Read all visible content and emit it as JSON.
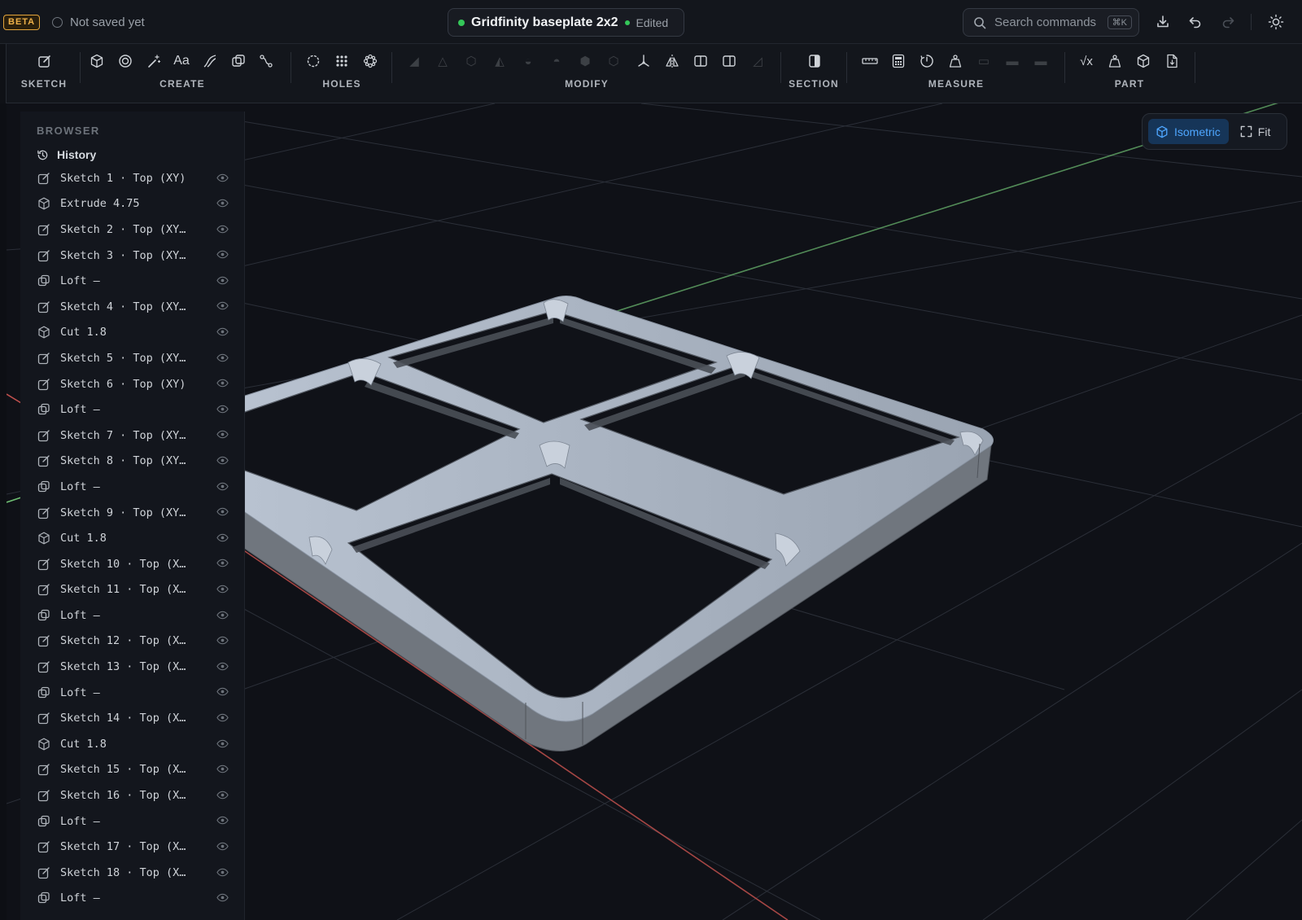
{
  "topbar": {
    "beta_label": "BETA",
    "save_status": "Not saved yet",
    "doc_title": "Gridfinity baseplate 2x2",
    "doc_state": "Edited",
    "search_placeholder": "Search commands",
    "search_shortcut": "⌘K",
    "icons": [
      "download-icon",
      "undo-icon",
      "redo-icon",
      "theme-sun-icon"
    ]
  },
  "ribbon": {
    "groups": [
      {
        "label": "SKETCH",
        "tools": [
          "sketch-icon"
        ]
      },
      {
        "label": "CREATE",
        "tools": [
          "extrude-icon",
          "revolve-icon",
          "magic-icon",
          "text-tool-icon",
          "loft-icon",
          "shape-icon",
          "sweep-icon"
        ]
      },
      {
        "label": "HOLES",
        "tools": [
          "hole-icon",
          "rect-pattern-icon",
          "circular-pattern-icon"
        ]
      },
      {
        "label": "MODIFY",
        "tools": [
          "fillet-icon",
          "chamfer-icon",
          "shell-icon",
          "draft-icon",
          "combine-icon",
          "offset-icon",
          "split-icon",
          "thicken-icon",
          "move-icon",
          "mirror-icon",
          "split-body-icon",
          "split-face-icon",
          "replace-icon"
        ]
      },
      {
        "label": "SECTION",
        "tools": [
          "section-icon"
        ]
      },
      {
        "label": "MEASURE",
        "tools": [
          "ruler-icon",
          "calculator-icon",
          "angle-icon",
          "mass-icon",
          "measure-a-icon",
          "measure-b-icon",
          "measure-c-icon"
        ]
      },
      {
        "label": "PART",
        "tools": [
          "sqrt-icon",
          "weight-icon",
          "part-cube-icon",
          "export-file-icon"
        ]
      }
    ]
  },
  "browser": {
    "title": "BROWSER",
    "history_label": "History",
    "items": [
      {
        "icon": "sketch",
        "label": "Sketch 1 · Top (XY)"
      },
      {
        "icon": "extrude",
        "label": "Extrude 4.75"
      },
      {
        "icon": "sketch",
        "label": "Sketch 2 · Top (XY…"
      },
      {
        "icon": "sketch",
        "label": "Sketch 3 · Top (XY…"
      },
      {
        "icon": "loft",
        "label": "Loft –"
      },
      {
        "icon": "sketch",
        "label": "Sketch 4 · Top (XY…"
      },
      {
        "icon": "extrude",
        "label": "Cut 1.8"
      },
      {
        "icon": "sketch",
        "label": "Sketch 5 · Top (XY…"
      },
      {
        "icon": "sketch",
        "label": "Sketch 6 · Top (XY)"
      },
      {
        "icon": "loft",
        "label": "Loft –"
      },
      {
        "icon": "sketch",
        "label": "Sketch 7 · Top (XY…"
      },
      {
        "icon": "sketch",
        "label": "Sketch 8 · Top (XY…"
      },
      {
        "icon": "loft",
        "label": "Loft –"
      },
      {
        "icon": "sketch",
        "label": "Sketch 9 · Top (XY…"
      },
      {
        "icon": "extrude",
        "label": "Cut 1.8"
      },
      {
        "icon": "sketch",
        "label": "Sketch 10 · Top (X…"
      },
      {
        "icon": "sketch",
        "label": "Sketch 11 · Top (X…"
      },
      {
        "icon": "loft",
        "label": "Loft –"
      },
      {
        "icon": "sketch",
        "label": "Sketch 12 · Top (X…"
      },
      {
        "icon": "sketch",
        "label": "Sketch 13 · Top (X…"
      },
      {
        "icon": "loft",
        "label": "Loft –"
      },
      {
        "icon": "sketch",
        "label": "Sketch 14 · Top (X…"
      },
      {
        "icon": "extrude",
        "label": "Cut 1.8"
      },
      {
        "icon": "sketch",
        "label": "Sketch 15 · Top (X…"
      },
      {
        "icon": "sketch",
        "label": "Sketch 16 · Top (X…"
      },
      {
        "icon": "loft",
        "label": "Loft –"
      },
      {
        "icon": "sketch",
        "label": "Sketch 17 · Top (X…"
      },
      {
        "icon": "sketch",
        "label": "Sketch 18 · Top (X…"
      },
      {
        "icon": "loft",
        "label": "Loft –"
      }
    ]
  },
  "view_controls": {
    "isometric_label": "Isometric",
    "fit_label": "Fit"
  },
  "colors": {
    "accent": "#4ea6ff",
    "saved_dot": "#34c759",
    "beta": "#f0b24a",
    "x_axis": "#c0504d",
    "y_axis": "#6fbf73",
    "model_top": "#a9b3c1",
    "model_side": "#6e747c"
  }
}
